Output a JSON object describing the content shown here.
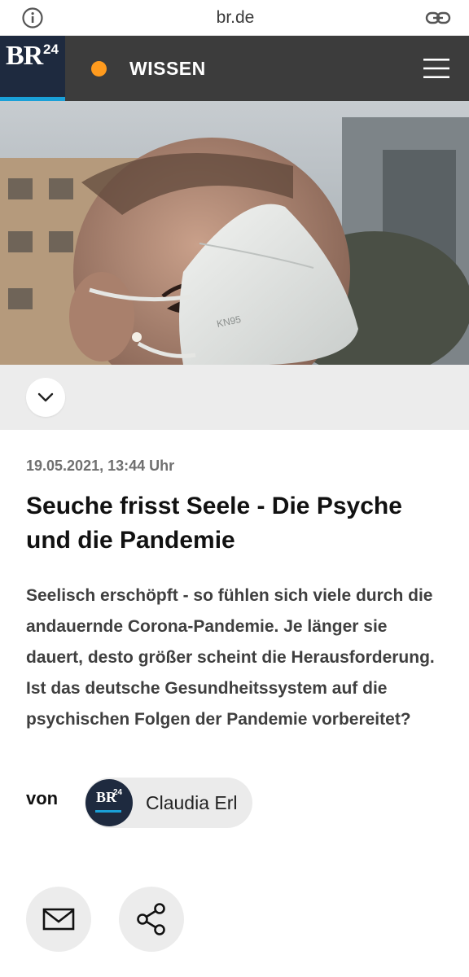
{
  "browser": {
    "url": "br.de",
    "info_icon": "info-icon",
    "link_icon": "link-icon"
  },
  "header": {
    "logo": {
      "brand": "BR",
      "number": "24"
    },
    "section": "WISSEN",
    "section_dot_color": "#ff9b1e",
    "menu_icon": "hamburger-menu-icon"
  },
  "hero": {
    "mask_label": "KN95"
  },
  "expander": {
    "icon": "chevron-down-icon"
  },
  "article": {
    "date": "19.05.2021, 13:44 Uhr",
    "title": "Seuche frisst Seele - Die Psyche und die Pandemie",
    "lead": "Seelisch erschöpft - so fühlen sich viele durch die andauernde Corona-Pandemie. Je länger sie dauert, desto größer scheint die Herausforderung. Ist das deutsche Gesundheitssystem auf die psychischen Folgen der Pandemie vorbereitet?"
  },
  "author": {
    "by_label": "von",
    "name": "Claudia Erl",
    "avatar": {
      "brand": "BR",
      "number": "24"
    }
  },
  "actions": {
    "mail_icon": "mail-icon",
    "share_icon": "share-icon"
  },
  "colors": {
    "header_bg": "#3c3c3c",
    "logo_bg": "#1e2a3f",
    "accent_blue": "#1aa0d8"
  }
}
